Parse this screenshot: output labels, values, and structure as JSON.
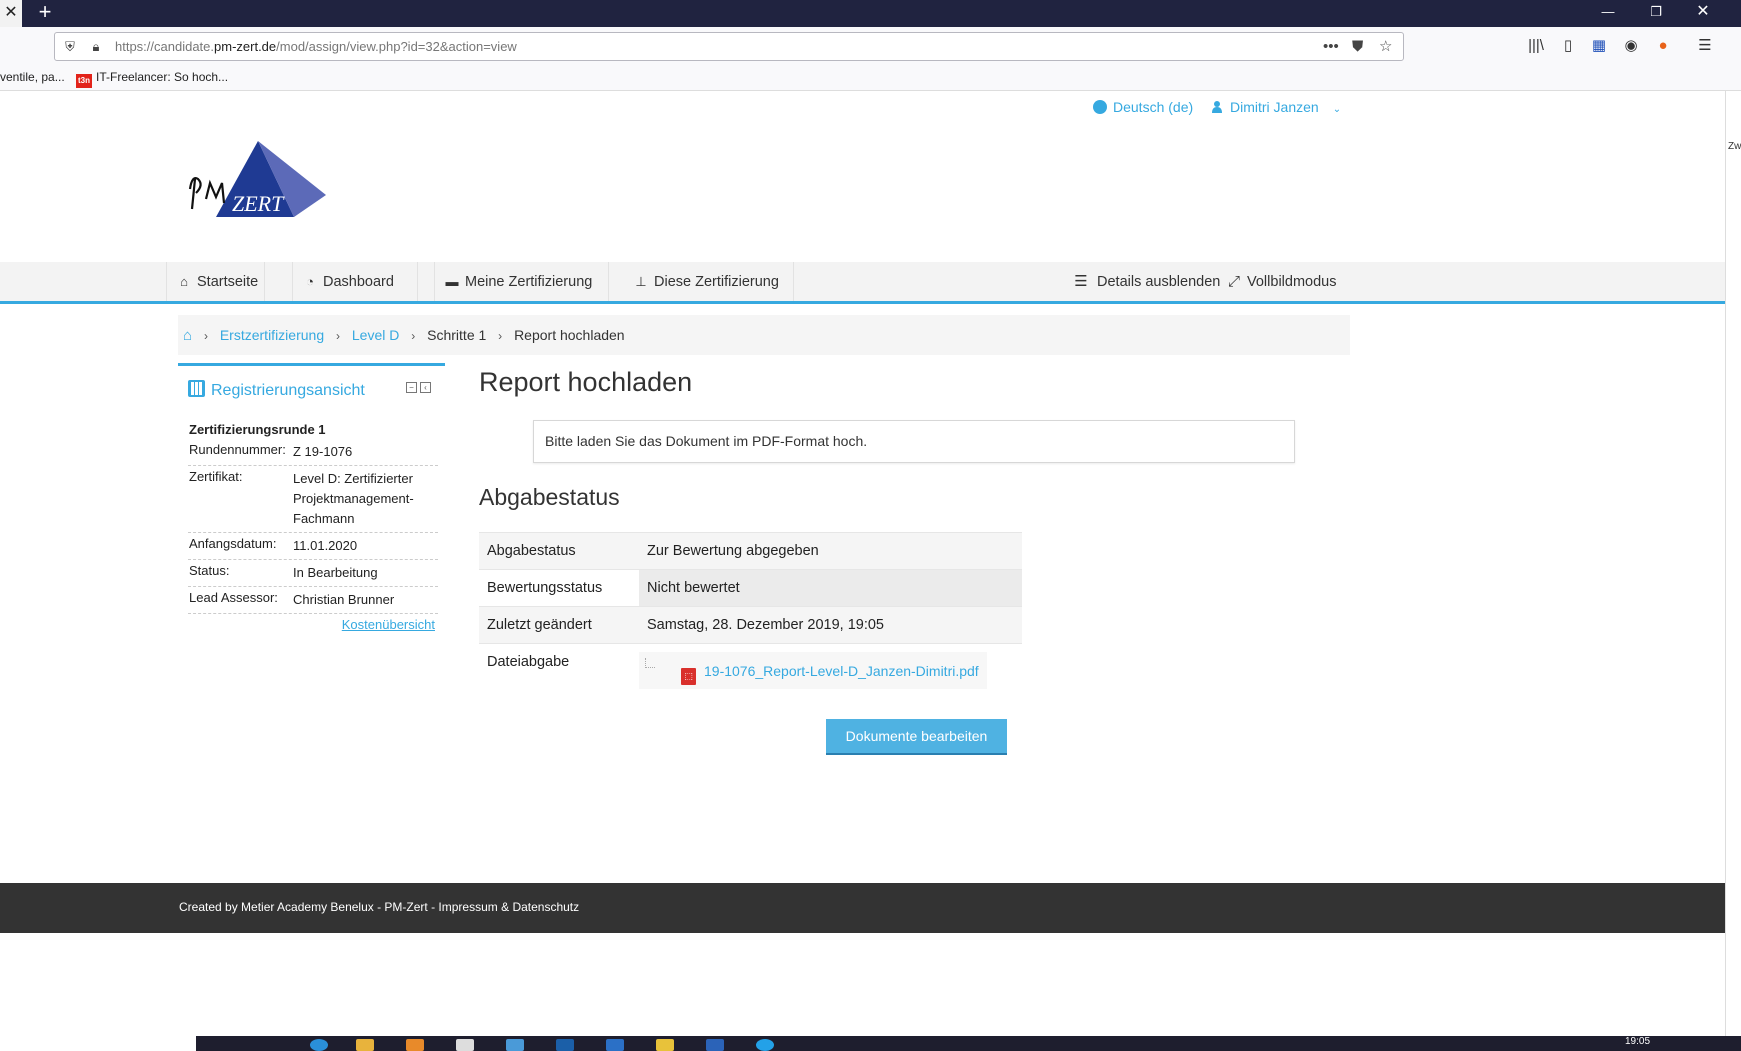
{
  "browser": {
    "url_prefix": "https://candidate.",
    "url_domain": "pm-zert.de",
    "url_path": "/mod/assign/view.php?id=32&action=view",
    "bookmarks": [
      {
        "label": "ventile, pa..."
      },
      {
        "label": "IT-Freelancer: So hoch...",
        "favicon": "t3n"
      }
    ],
    "edge_text": "Zw"
  },
  "header": {
    "language": "Deutsch (de)",
    "user": "Dimitri Janzen",
    "logo_text": "PM ZERT"
  },
  "nav": {
    "items": [
      {
        "label": "Startseite",
        "icon": "home-icon"
      },
      {
        "label": "Dashboard",
        "icon": "dashboard-icon"
      },
      {
        "label": "Meine Zertifizierung",
        "icon": "briefcase-icon"
      },
      {
        "label": "Diese Zertifizierung",
        "icon": "sitemap-icon"
      }
    ],
    "right": [
      {
        "label": "Details ausblenden",
        "icon": "list-icon"
      },
      {
        "label": "Vollbildmodus",
        "icon": "expand-icon"
      }
    ]
  },
  "breadcrumb": {
    "items": [
      "Erstzertifizierung",
      "Level D",
      "Schritte 1",
      "Report hochladen"
    ]
  },
  "sidebar": {
    "title": "Registrierungsansicht",
    "round_title": "Zertifizierungsrunde 1",
    "rows": [
      {
        "key": "Rundennummer:",
        "value": "Z 19-1076"
      },
      {
        "key": "Zertifikat:",
        "value": "Level D: Zertifizierter Projektmanagement-Fachmann"
      },
      {
        "key": "Anfangsdatum:",
        "value": "11.01.2020"
      },
      {
        "key": "Status:",
        "value": "In Bearbeitung"
      },
      {
        "key": "Lead Assessor:",
        "value": "Christian Brunner"
      }
    ],
    "link": "Kostenübersicht"
  },
  "main": {
    "title": "Report hochladen",
    "notice": "Bitte laden Sie das Dokument im PDF-Format hoch.",
    "status_heading": "Abgabestatus",
    "status_rows": [
      {
        "key": "Abgabestatus",
        "value": "Zur Bewertung abgegeben"
      },
      {
        "key": "Bewertungsstatus",
        "value": "Nicht bewertet"
      },
      {
        "key": "Zuletzt geändert",
        "value": "Samstag, 28. Dezember 2019, 19:05"
      },
      {
        "key": "Dateiabgabe",
        "value": "19-1076_Report-Level-D_Janzen-Dimitri.pdf"
      }
    ],
    "button": "Dokumente bearbeiten"
  },
  "footer": {
    "text": "Created by Metier Academy Benelux - PM-Zert  - Impressum & Datenschutz"
  },
  "taskbar": {
    "clock": "19:05"
  },
  "colors": {
    "accent": "#36a9e0",
    "tabstrip": "#202340",
    "footer": "#333333",
    "button": "#4fb2e2"
  }
}
